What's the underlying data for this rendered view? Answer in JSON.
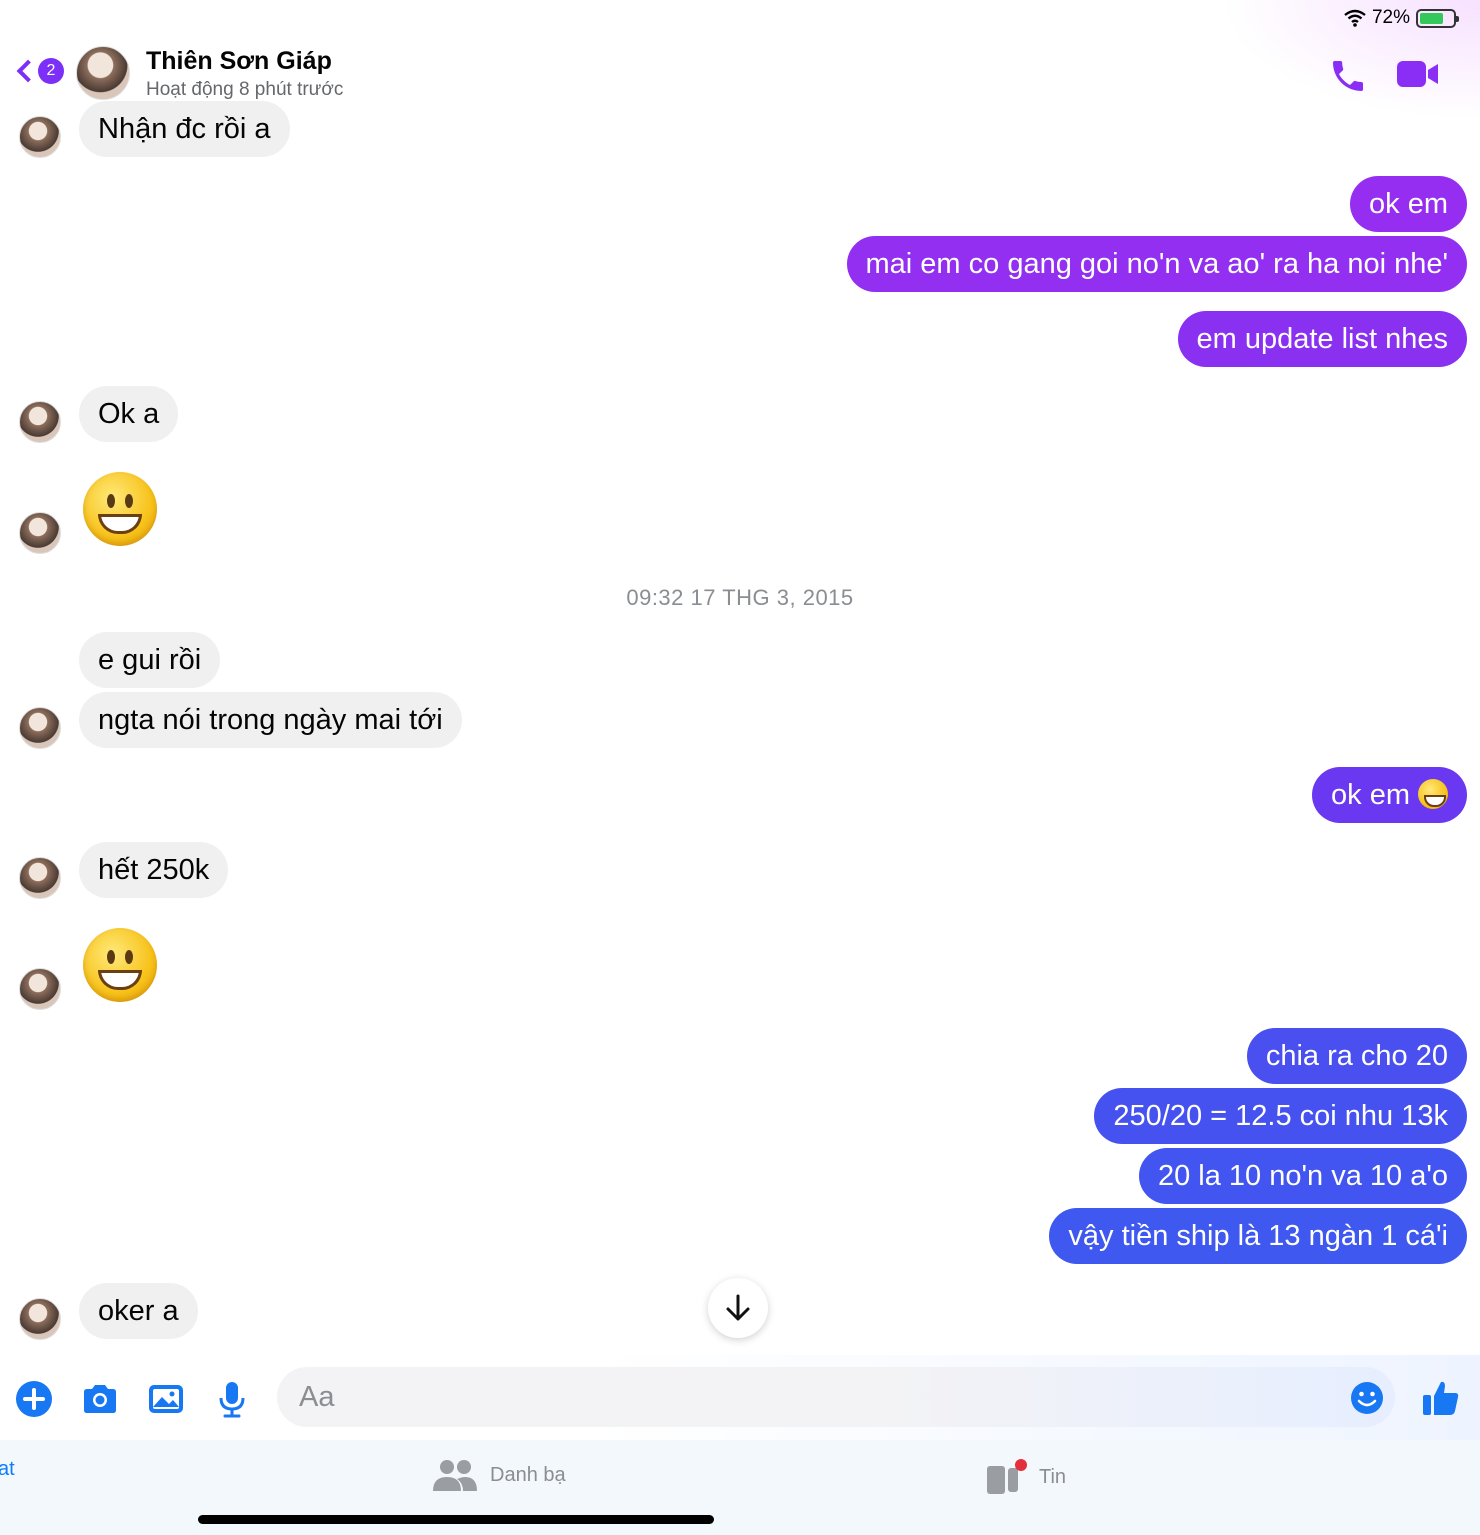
{
  "status_bar": {
    "battery_percent": "72%",
    "battery_level": 0.72,
    "wifi_icon": "wifi-icon"
  },
  "header": {
    "back_badge": "2",
    "contact_name": "Thiên Sơn Giáp",
    "contact_status": "Hoạt động 8 phút trước"
  },
  "messages": [
    {
      "side": "in",
      "text": "Nhận đc rồi a"
    },
    {
      "side": "out",
      "text": "ok em"
    },
    {
      "side": "out",
      "text": "mai em co gang goi no'n va ao' ra ha noi nhe'"
    },
    {
      "side": "out",
      "text": "em update list nhes"
    },
    {
      "side": "in",
      "text": "Ok a"
    },
    {
      "side": "in",
      "emoji": "grinning-face"
    },
    {
      "side": "in",
      "text": "e gui rồi"
    },
    {
      "side": "in",
      "text": "ngta nói trong ngày mai tới"
    },
    {
      "side": "out",
      "text": "ok em"
    },
    {
      "side": "in",
      "text": "hết 250k"
    },
    {
      "side": "in",
      "emoji": "grinning-face"
    },
    {
      "side": "out",
      "text": "chia ra cho 20"
    },
    {
      "side": "out",
      "text": "250/20 = 12.5 coi nhu 13k"
    },
    {
      "side": "out",
      "text": "20 la 10 no'n va 10 a'o"
    },
    {
      "side": "out",
      "text": "vậy tiền ship là 13 ngàn 1 cá'i"
    },
    {
      "side": "in",
      "text": "oker a"
    }
  ],
  "timestamp": "09:32 17 THG 3, 2015",
  "composer": {
    "placeholder": "Aa"
  },
  "tabbar": {
    "chats_label": "at",
    "contacts_label": "Danh bạ",
    "stories_label": "Tin"
  },
  "colors": {
    "accent_purple": "#7b2ff7",
    "outgoing_top": "#9a2ef0",
    "outgoing_bottom": "#3b5ef0",
    "incoming_bg": "#f0f0f0"
  }
}
